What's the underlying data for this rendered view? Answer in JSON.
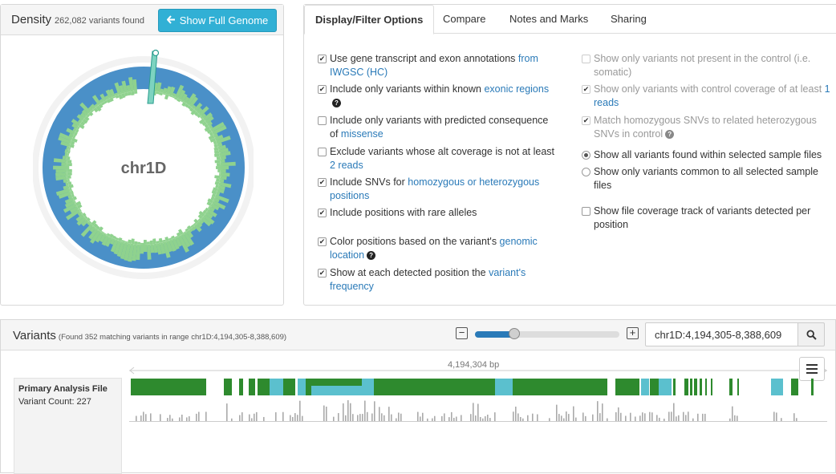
{
  "colors": {
    "accent": "#31b0d5",
    "ring_blue": "#4a90c8",
    "density_green": "#8fd28e",
    "track_green": "#2e8a2e",
    "track_cyan": "#5bc0ce",
    "link": "#2a7ab8"
  },
  "density": {
    "title": "Density",
    "subtitle": "262,082 variants found",
    "show_genome_label": "Show Full Genome",
    "chromosome": "chr1D"
  },
  "tabs": [
    {
      "label": "Display/Filter Options",
      "active": true
    },
    {
      "label": "Compare"
    },
    {
      "label": "Notes and Marks"
    },
    {
      "label": "Sharing"
    }
  ],
  "options_left": [
    {
      "checked": true,
      "text": "Use gene transcript and exon annotations ",
      "link": "from IWGSC (HC)"
    },
    {
      "checked": true,
      "text": "Include only variants within known ",
      "link": "exonic regions",
      "help": "?"
    },
    {
      "checked": false,
      "text": "Include only variants with predicted consequence of ",
      "link": "missense"
    },
    {
      "checked": false,
      "text": "Exclude variants whose alt coverage is not at least ",
      "link": "2 reads"
    },
    {
      "checked": true,
      "text": "Include SNVs for ",
      "link": "homozygous or heterozygous positions"
    },
    {
      "checked": true,
      "text": "Include positions with rare alleles"
    },
    {
      "checked": true,
      "text": "Color positions based on the variant's ",
      "link": "genomic location",
      "help": "?"
    },
    {
      "checked": true,
      "text": "Show at each detected position the ",
      "link": "variant's frequency"
    }
  ],
  "options_right": [
    {
      "checked": false,
      "disabled": true,
      "text": "Show only variants not present in the control (i.e. somatic)"
    },
    {
      "checked": true,
      "disabled": true,
      "text": "Show only variants with control coverage of at least ",
      "link": "1 reads"
    },
    {
      "checked": true,
      "disabled": true,
      "text": "Match homozygous SNVs to related heterozygous SNVs in control",
      "help": "?"
    },
    {
      "radio": true,
      "checked": true,
      "text": "Show all variants found within selected sample files"
    },
    {
      "radio": true,
      "checked": false,
      "text": "Show only variants common to all selected sample files"
    },
    {
      "checked": false,
      "text": "Show file coverage track of variants detected per position"
    }
  ],
  "variants": {
    "title": "Variants",
    "subtitle": "(Found 352 matching variants in range chr1D:4,194,305-8,388,609)",
    "region_value": "chr1D:4,194,305-8,388,609",
    "range_label": "4,194,304 bp",
    "zoom_level": 0.27,
    "track_name": "Primary Analysis File",
    "track_count": "Variant Count: 227"
  }
}
